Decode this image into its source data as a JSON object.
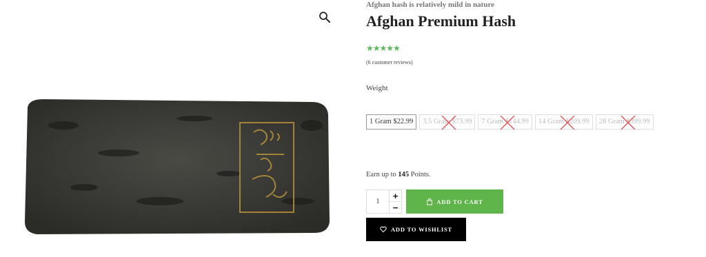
{
  "product": {
    "tagline": "Afghan hash is relatively mild in nature",
    "title": "Afghan Premium Hash",
    "rating_stars": "★★★★★",
    "reviews_link": "(6 customer reviews)"
  },
  "gallery": {
    "zoom_icon": "magnifier-icon",
    "stamp_color": "#b8923a",
    "product_color": "#3a3a36"
  },
  "options": {
    "label": "Weight",
    "variants": [
      {
        "label": "1 Gram $22.99",
        "available": true,
        "selected": true
      },
      {
        "label": "3.5 Gram $73.99",
        "available": false,
        "selected": false
      },
      {
        "label": "7 Gram $144.99",
        "available": false,
        "selected": false
      },
      {
        "label": "14 Gram $209.99",
        "available": false,
        "selected": false
      },
      {
        "label": "28 Gram $399.99",
        "available": false,
        "selected": false
      }
    ]
  },
  "points": {
    "prefix": "Earn up to",
    "amount": "145",
    "suffix": "Points."
  },
  "cart": {
    "quantity": "1",
    "plus": "+",
    "minus": "−",
    "add_to_cart_label": "ADD TO CART",
    "add_to_cart_icon": "bag-icon",
    "wishlist_label": "ADD TO WISHLIST",
    "wishlist_icon": "heart-icon"
  },
  "colors": {
    "accent_green": "#5fb54a",
    "star_green": "#5cb85c",
    "unavailable_cross": "#e05555"
  }
}
